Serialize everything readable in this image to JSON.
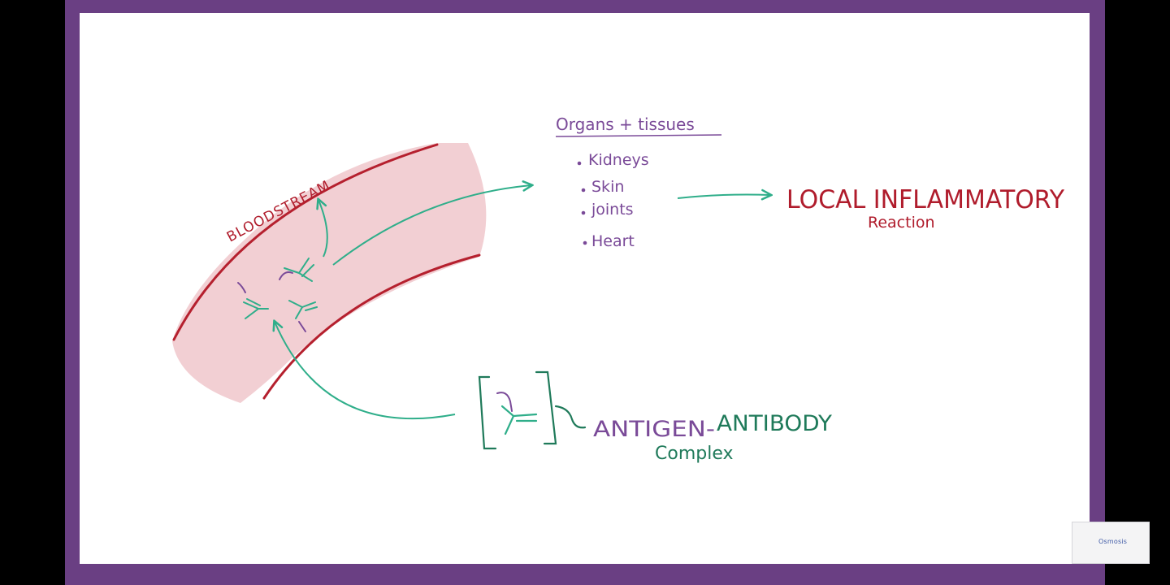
{
  "labels": {
    "bloodstream": "BLOODSTREAM",
    "organs_heading": "Organs + tissues",
    "organs": [
      "Kidneys",
      "Skin",
      "joints",
      "Heart"
    ],
    "local_inflammatory": "LOCAL INFLAMMATORY",
    "reaction": "Reaction",
    "antigen": "ANTIGEN-",
    "antibody": "ANTIBODY",
    "complex": "Complex"
  },
  "watermark": {
    "text": "Osmosis"
  },
  "colors": {
    "frame": "#6a3f83",
    "vessel_fill": "#f2cfd3",
    "vessel_wall": "#b5202e",
    "teal": "#2fae8a",
    "purple": "#7a4a98",
    "dark_green": "#1f7a5a",
    "red_text": "#b01c2c"
  },
  "icons": [
    "antibody-icon",
    "antigen-strand-icon",
    "arrow-icon",
    "bracket-icon"
  ]
}
